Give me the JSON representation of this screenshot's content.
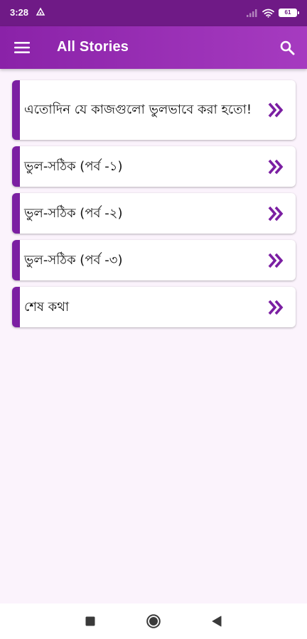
{
  "status_bar": {
    "time": "3:28",
    "battery": "61"
  },
  "app_bar": {
    "title": "All Stories"
  },
  "stories": [
    {
      "title": "এতোদিন যে কাজগুলো ভুলভাবে করা হতো!"
    },
    {
      "title": "ভুল-সঠিক (পর্ব -১)"
    },
    {
      "title": "ভুল-সঠিক (পর্ব -২)"
    },
    {
      "title": "ভুল-সঠিক (পর্ব -৩)"
    },
    {
      "title": "শেষ কথা"
    }
  ],
  "icons": {
    "menu": "menu-icon",
    "search": "search-icon",
    "chevron": "double-chevron-right-icon",
    "nav_recents": "square-icon",
    "nav_home": "circle-icon",
    "nav_back": "triangle-back-icon"
  },
  "colors": {
    "status_bar": "#6f1a86",
    "app_bar": "#9b2fb8",
    "accent": "#7b1fa2",
    "background": "#fbf3fc"
  }
}
